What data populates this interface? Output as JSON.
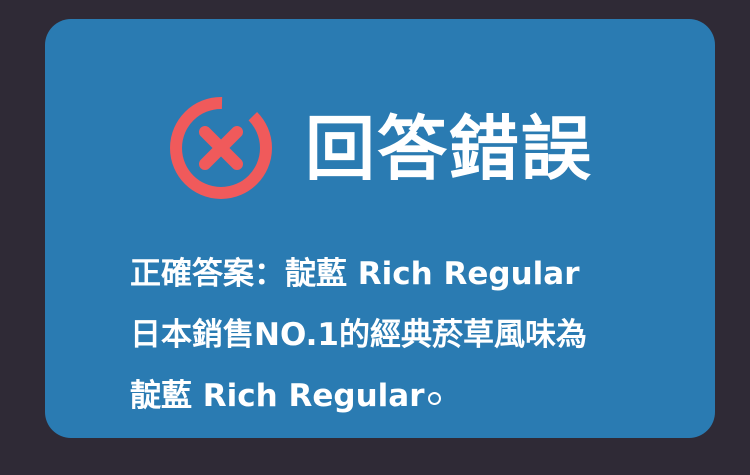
{
  "result": {
    "title": "回答錯誤",
    "icon": "wrong-answer-icon",
    "accent_color": "#f05a5b"
  },
  "answer": {
    "prefix": "正確答案：",
    "product": "靛藍 Rich Regular"
  },
  "description": {
    "line1": "日本銷售NO.1的經典菸草風味為",
    "line2_product": "靛藍 Rich Regular"
  },
  "colors": {
    "background": "#2f2a36",
    "card": "#2a7bb2",
    "text": "#ffffff"
  }
}
